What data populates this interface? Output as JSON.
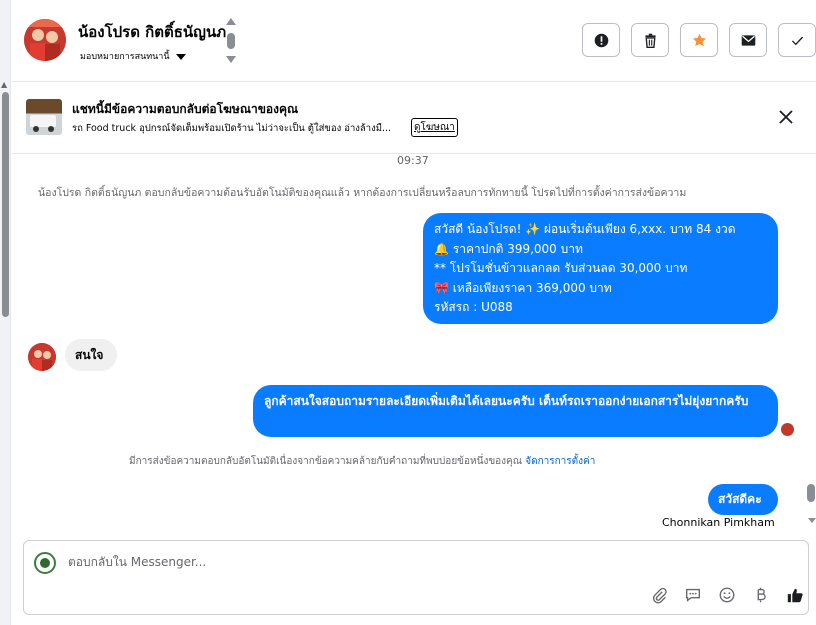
{
  "header": {
    "contact_name": "น้องโปรด กิตติ์ธนัญนภ",
    "assignee": "มอบหมายการสนทนานี้"
  },
  "ad": {
    "title": "แชทนี้มีข้อความตอบกลับต่อโฆษณาของคุณ",
    "description": "รถ Food truck อุปกรณ์จัดเต็มพร้อมเปิดร้าน ไม่ว่าจะเป็น ตู้ใส่ของ อ่างล้างมื...",
    "link": "ดูโฆษณา"
  },
  "chat": {
    "time": "09:37",
    "system_notice_1": "น้องโปรด กิตติ์ธนัญนภ ตอบกลับข้อความต้อนรับอัตโนมัติของคุณแล้ว หากต้องการเปลี่ยนหรือลบการทักทายนี้ โปรดไปที่การตั้งค่าการส่งข้อความ",
    "welcome_lines": [
      "สวัสดี น้องโปรด! ✨  ผ่อนเริ่มต้นเพียง 6,xxx. บาท 84 งวด",
      "🔔 ราคาปกติ 399,000 บาท",
      "** โปรโมชั่นข้าวแลกลด รับส่วนลด 30,000 บาท",
      "🎀  เหลือเพียงราคา 369,000 บาท",
      " รหัสรถ : U088"
    ],
    "customer_message": "สนใจ",
    "agent_reply": "ลูกค้าสนใจสอบถามรายละเอียดเพิ่มเติมได้เลยนะครับ เต็นท์รถเราออกง่ายเอกสารไม่ยุ่งยากครับ",
    "system_notice_2": "มีการส่งข้อความตอบกลับอัตโนมัติเนื่องจากข้อความคล้ายกับคำถามที่พบบ่อยข้อหนึ่งของคุณ",
    "system_notice_2_link": "จัดการการตั้งค่า",
    "last_message": "สวัสดีคะ",
    "last_sender": "Chonnikan Pimkham"
  },
  "composer": {
    "placeholder": "ตอบกลับใน Messenger..."
  },
  "colors": {
    "bubble_blue": "#0a7cff",
    "bubble_gray": "#f0f0f0",
    "star_orange": "#f7923a"
  }
}
